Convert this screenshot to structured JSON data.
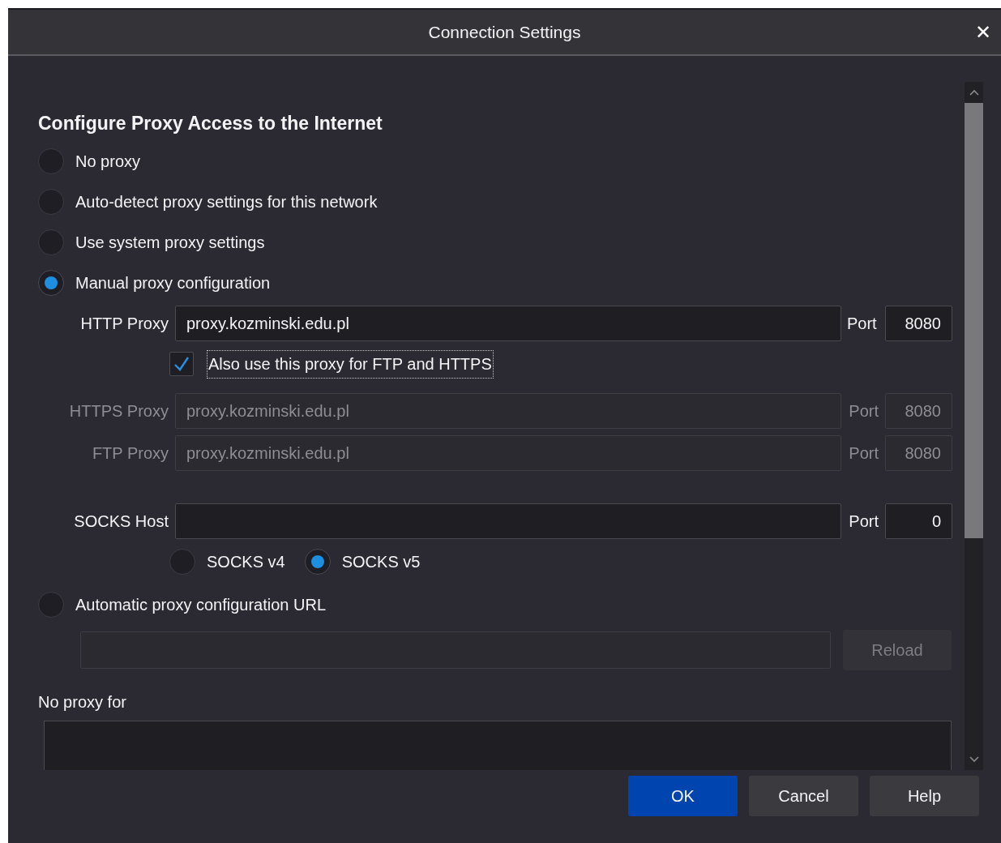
{
  "window": {
    "title": "Connection Settings",
    "close_label": "✕"
  },
  "heading": "Configure Proxy Access to the Internet",
  "proxy_modes": [
    {
      "label": "No proxy",
      "selected": false
    },
    {
      "label": "Auto-detect proxy settings for this network",
      "selected": false
    },
    {
      "label": "Use system proxy settings",
      "selected": false
    },
    {
      "label": "Manual proxy configuration",
      "selected": true
    }
  ],
  "manual": {
    "proxies": [
      {
        "label": "HTTP Proxy",
        "value": "proxy.kozminski.edu.pl",
        "port_label": "Port",
        "port": "8080",
        "disabled": false
      },
      {
        "label": "HTTPS Proxy",
        "value": "proxy.kozminski.edu.pl",
        "port_label": "Port",
        "port": "8080",
        "disabled": true
      },
      {
        "label": "FTP Proxy",
        "value": "proxy.kozminski.edu.pl",
        "port_label": "Port",
        "port": "8080",
        "disabled": true
      }
    ],
    "share_checkbox": {
      "label": "Also use this proxy for FTP and HTTPS",
      "checked": true
    },
    "socks": {
      "label": "SOCKS Host",
      "port_label": "Port",
      "port": "0",
      "versions": [
        {
          "label": "SOCKS v4",
          "selected": false
        },
        {
          "label": "SOCKS v5",
          "selected": true
        }
      ]
    }
  },
  "auto_config": {
    "label": "Automatic proxy configuration URL",
    "selected": false,
    "reload_button": {
      "label": "Reload",
      "disabled": true
    }
  },
  "no_proxy_for": {
    "label": "No proxy for"
  },
  "buttons": [
    {
      "label": "OK",
      "kind": "primary"
    },
    {
      "label": "Cancel",
      "kind": "secondary"
    },
    {
      "label": "Help",
      "kind": "secondary"
    }
  ]
}
